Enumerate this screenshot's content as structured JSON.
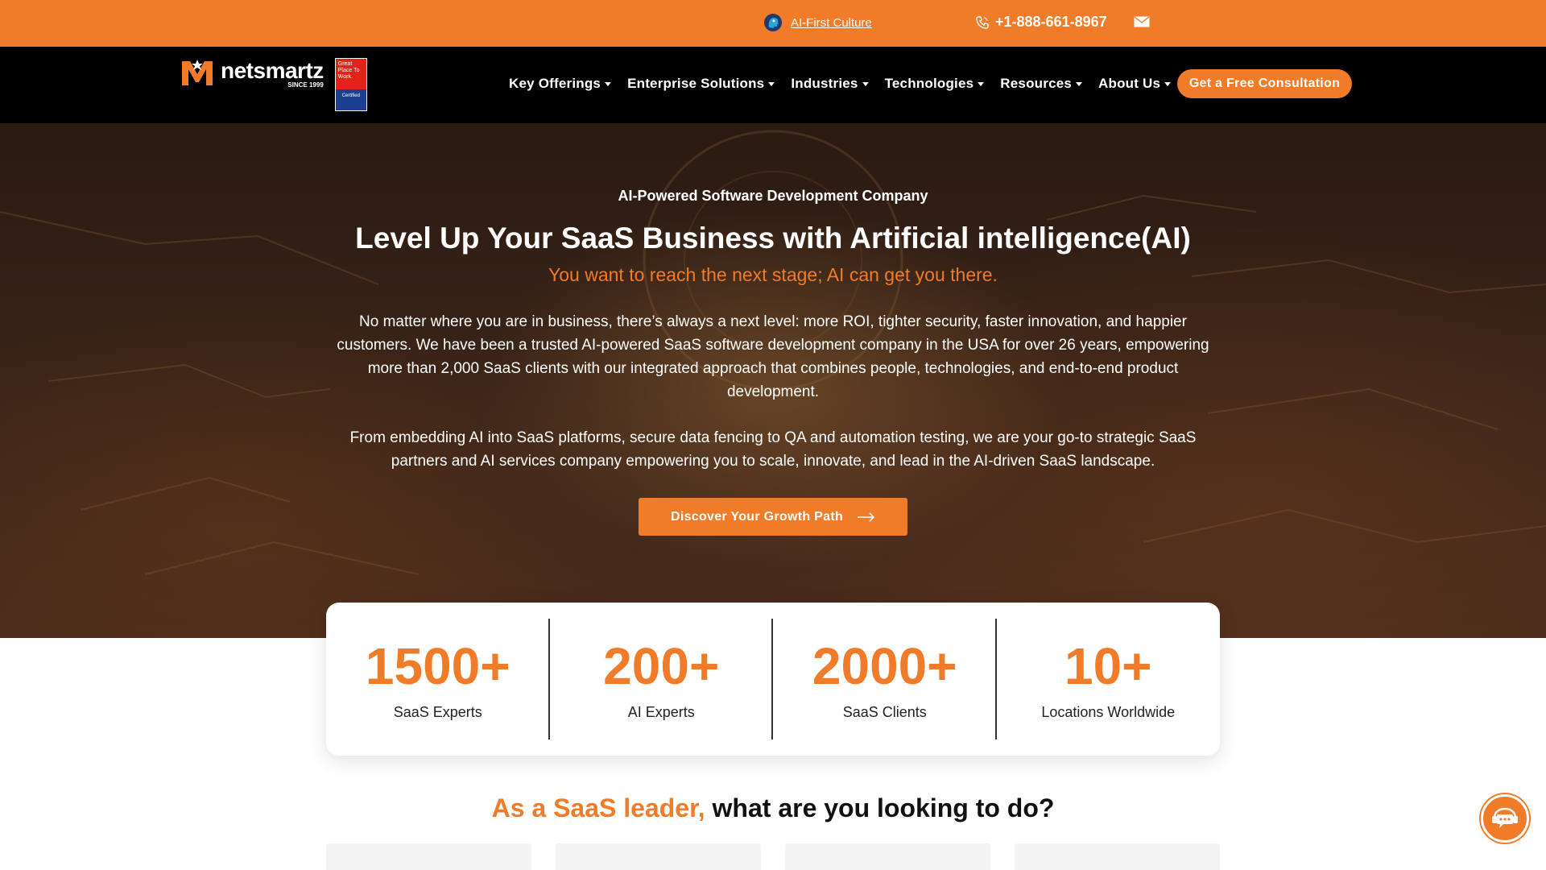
{
  "topbar": {
    "ai_link": "AI-First Culture",
    "phone": "+1-888-661-8967",
    "icons": [
      "ai-head-icon",
      "phone-icon",
      "mail-icon"
    ]
  },
  "logo": {
    "name": "netsmartz",
    "since": "SINCE 1999",
    "badge_text": "Great Place To Work.",
    "badge_certified": "Certified"
  },
  "nav": {
    "items": [
      {
        "label": "Key Offerings"
      },
      {
        "label": "Enterprise Solutions"
      },
      {
        "label": "Industries"
      },
      {
        "label": "Technologies"
      },
      {
        "label": "Resources"
      },
      {
        "label": "About Us"
      }
    ],
    "cta": "Get a Free Consultation"
  },
  "hero": {
    "eyebrow": "AI-Powered Software Development Company",
    "title": "Level Up Your SaaS Business with Artificial intelligence(AI)",
    "subtitle": "You want to reach the next stage; AI can get you there.",
    "paragraph1": "No matter where you are in business, there’s always a next level: more ROI, tighter security, faster innovation, and happier customers. We have been a trusted AI-powered SaaS software development company in the USA for over 26 years, empowering more than 2,000 SaaS clients with our integrated approach that combines people, technologies, and end-to-end product development.",
    "paragraph2": "From embedding AI into SaaS platforms, secure data fencing to QA and automation testing, we are your go-to strategic SaaS partners and AI services company empowering you to scale, innovate, and lead in the AI-driven SaaS landscape.",
    "button": "Discover Your Growth Path"
  },
  "stats": [
    {
      "value": "1500+",
      "label": "SaaS Experts"
    },
    {
      "value": "200+",
      "label": "AI Experts"
    },
    {
      "value": "2000+",
      "label": "SaaS Clients"
    },
    {
      "value": "10+",
      "label": "Locations Worldwide"
    }
  ],
  "section": {
    "accent": "As a SaaS leader,",
    "rest": " what are you looking to do?"
  },
  "colors": {
    "brand_orange": "#f07c2a",
    "nav_black": "#000000"
  }
}
